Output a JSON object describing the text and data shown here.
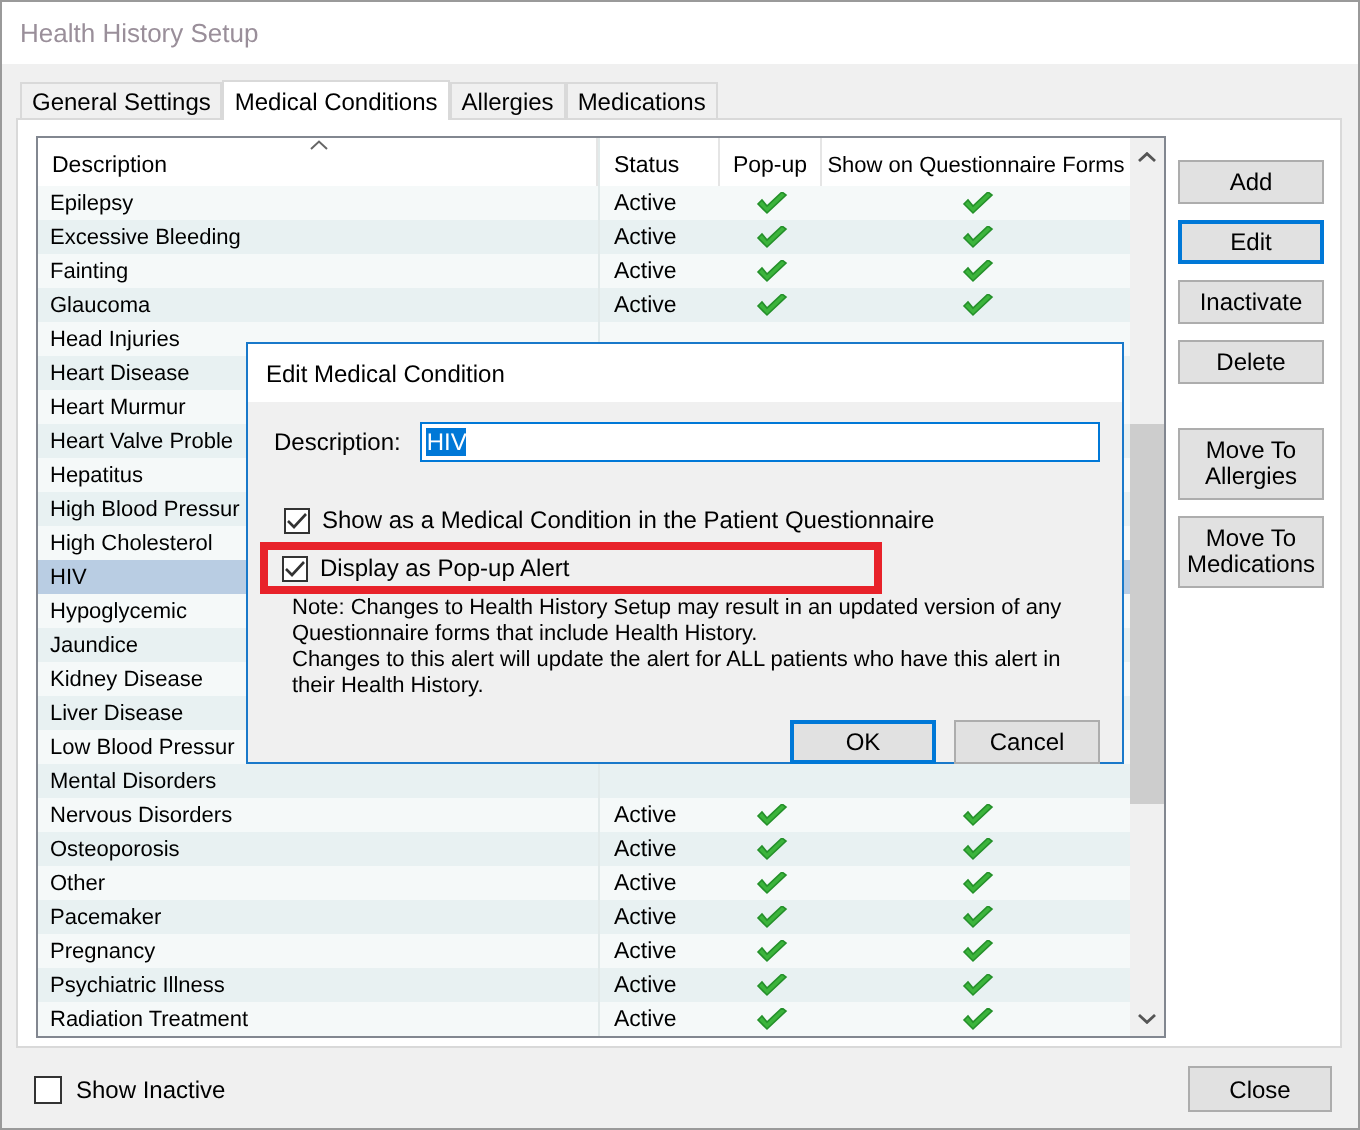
{
  "window": {
    "title": "Health History Setup"
  },
  "tabs": [
    {
      "label": "General Settings",
      "selected": false
    },
    {
      "label": "Medical Conditions",
      "selected": true
    },
    {
      "label": "Allergies",
      "selected": false
    },
    {
      "label": "Medications",
      "selected": false
    }
  ],
  "table": {
    "columns": [
      "Description",
      "Status",
      "Pop-up",
      "Show on Questionnaire Forms"
    ],
    "rows": [
      {
        "description": "Epilepsy",
        "status": "Active",
        "popup": true,
        "questionnaire": true,
        "selected": false
      },
      {
        "description": "Excessive Bleeding",
        "status": "Active",
        "popup": true,
        "questionnaire": true,
        "selected": false
      },
      {
        "description": "Fainting",
        "status": "Active",
        "popup": true,
        "questionnaire": true,
        "selected": false
      },
      {
        "description": "Glaucoma",
        "status": "Active",
        "popup": true,
        "questionnaire": true,
        "selected": false
      },
      {
        "description": "Head Injuries",
        "selected": false
      },
      {
        "description": "Heart Disease",
        "selected": false
      },
      {
        "description": "Heart Murmur",
        "selected": false
      },
      {
        "description": "Heart Valve Proble",
        "selected": false
      },
      {
        "description": "Hepatitus",
        "selected": false
      },
      {
        "description": "High Blood Pressur",
        "selected": false
      },
      {
        "description": "High Cholesterol",
        "selected": false
      },
      {
        "description": "HIV",
        "selected": true
      },
      {
        "description": "Hypoglycemic",
        "selected": false
      },
      {
        "description": "Jaundice",
        "selected": false
      },
      {
        "description": "Kidney Disease",
        "selected": false
      },
      {
        "description": "Liver Disease",
        "selected": false
      },
      {
        "description": "Low Blood Pressur",
        "selected": false
      },
      {
        "description": "Mental Disorders",
        "selected": false
      },
      {
        "description": "Nervous Disorders",
        "status": "Active",
        "popup": true,
        "questionnaire": true,
        "selected": false
      },
      {
        "description": "Osteoporosis",
        "status": "Active",
        "popup": true,
        "questionnaire": true,
        "selected": false
      },
      {
        "description": "Other",
        "status": "Active",
        "popup": true,
        "questionnaire": true,
        "selected": false
      },
      {
        "description": "Pacemaker",
        "status": "Active",
        "popup": true,
        "questionnaire": true,
        "selected": false
      },
      {
        "description": "Pregnancy",
        "status": "Active",
        "popup": true,
        "questionnaire": true,
        "selected": false
      },
      {
        "description": "Psychiatric Illness",
        "status": "Active",
        "popup": true,
        "questionnaire": true,
        "selected": false
      },
      {
        "description": "Radiation Treatment",
        "status": "Active",
        "popup": true,
        "questionnaire": true,
        "selected": false
      }
    ]
  },
  "side_buttons": [
    {
      "label": "Add",
      "focused": false
    },
    {
      "label": "Edit",
      "focused": true
    },
    {
      "label": "Inactivate",
      "focused": false
    },
    {
      "label": "Delete",
      "focused": false
    },
    {
      "label": "Move To Allergies",
      "focused": false
    },
    {
      "label": "Move To Medications",
      "focused": false
    }
  ],
  "show_inactive": {
    "label": "Show Inactive",
    "checked": false
  },
  "close_button": "Close",
  "dialog": {
    "title": "Edit Medical Condition",
    "description_label": "Description:",
    "description_value": "HIV",
    "checkboxes": [
      {
        "label": "Show as a Medical Condition in the Patient Questionnaire",
        "checked": true,
        "highlighted": false
      },
      {
        "label": "Display as Pop-up Alert",
        "checked": true,
        "highlighted": true
      }
    ],
    "note": [
      "Note: Changes to Health History Setup may result in an updated version of any Questionnaire forms that include Health History.",
      "Changes to this alert will update the alert for ALL patients who have this alert in their Health History."
    ],
    "buttons": [
      {
        "label": "OK",
        "focused": true
      },
      {
        "label": "Cancel",
        "focused": false
      }
    ]
  }
}
